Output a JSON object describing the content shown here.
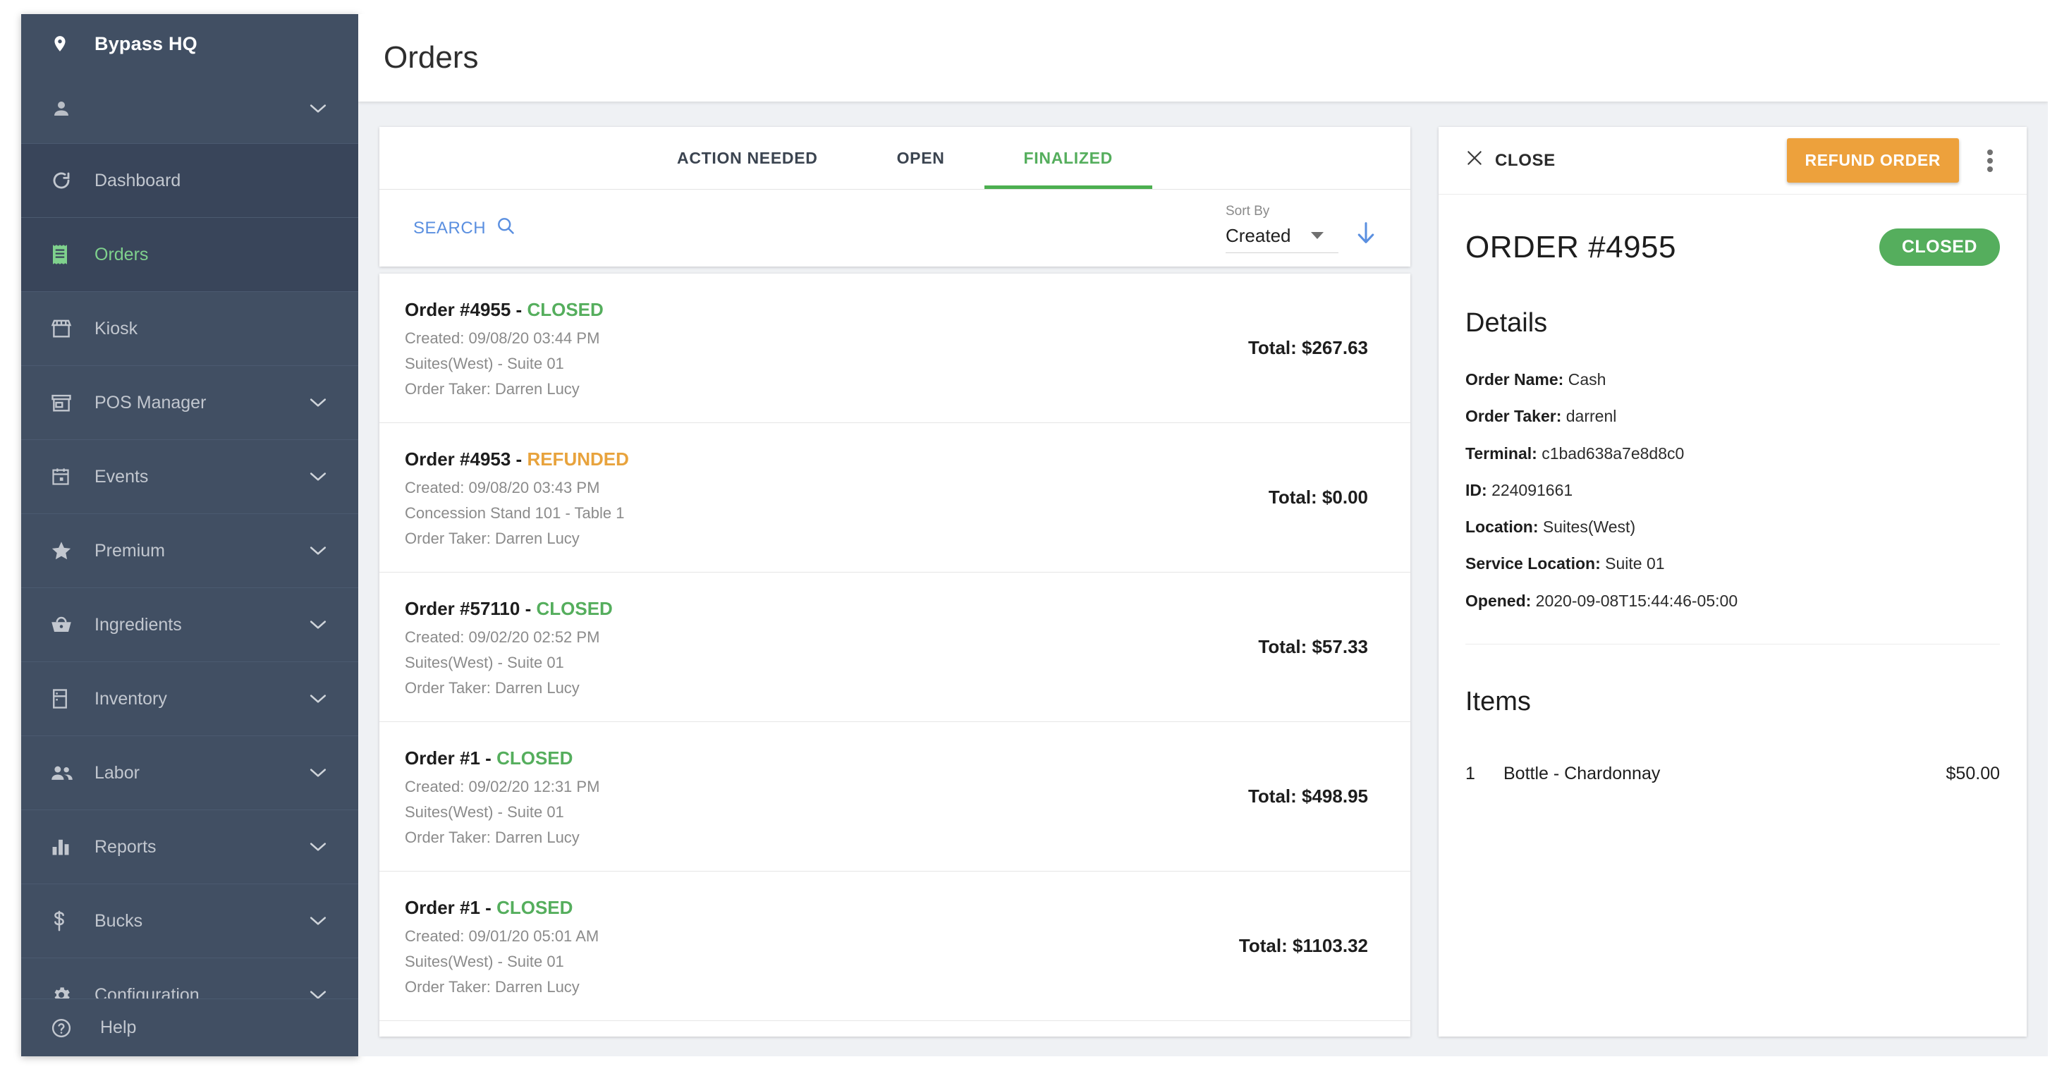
{
  "colors": {
    "sidebar_bg": "#414f63",
    "sidebar_active_bg": "#39455a",
    "accent_green": "#55ae5d",
    "accent_orange": "#eda13c",
    "link_blue": "#5a8fe0",
    "page_bg": "#eff1f4"
  },
  "sidebar": {
    "brand": {
      "label": "Bypass HQ",
      "icon": "location-pin-icon"
    },
    "user": {
      "label": "",
      "icon": "person-icon",
      "chevron": "chevron-down-icon"
    },
    "items": [
      {
        "label": "Dashboard",
        "icon": "dashboard-icon",
        "expandable": false,
        "active": false,
        "highlight": true
      },
      {
        "label": "Orders",
        "icon": "receipt-icon",
        "expandable": false,
        "active": true,
        "highlight": true
      },
      {
        "label": "Kiosk",
        "icon": "kiosk-icon",
        "expandable": false,
        "active": false,
        "highlight": false
      },
      {
        "label": "POS Manager",
        "icon": "store-icon",
        "expandable": true,
        "active": false,
        "highlight": false
      },
      {
        "label": "Events",
        "icon": "calendar-icon",
        "expandable": true,
        "active": false,
        "highlight": false
      },
      {
        "label": "Premium",
        "icon": "star-icon",
        "expandable": true,
        "active": false,
        "highlight": false
      },
      {
        "label": "Ingredients",
        "icon": "basket-icon",
        "expandable": true,
        "active": false,
        "highlight": false
      },
      {
        "label": "Inventory",
        "icon": "fridge-icon",
        "expandable": true,
        "active": false,
        "highlight": false
      },
      {
        "label": "Labor",
        "icon": "people-icon",
        "expandable": true,
        "active": false,
        "highlight": false
      },
      {
        "label": "Reports",
        "icon": "bar-chart-icon",
        "expandable": true,
        "active": false,
        "highlight": false
      },
      {
        "label": "Bucks",
        "icon": "dollar-icon",
        "expandable": true,
        "active": false,
        "highlight": false
      },
      {
        "label": "Configuration",
        "icon": "gear-icon",
        "expandable": true,
        "active": false,
        "highlight": false
      }
    ],
    "help": {
      "label": "Help",
      "icon": "help-circle-icon"
    }
  },
  "header": {
    "title": "Orders"
  },
  "tabs": [
    {
      "label": "ACTION NEEDED",
      "selected": false
    },
    {
      "label": "OPEN",
      "selected": false
    },
    {
      "label": "FINALIZED",
      "selected": true
    }
  ],
  "toolbar": {
    "search_label": "SEARCH",
    "search_icon": "magnifier-icon",
    "sort_label": "Sort By",
    "sort_value": "Created",
    "sort_direction_icon": "arrow-down-icon"
  },
  "orders": [
    {
      "title_prefix": "Order #4955 - ",
      "status": "CLOSED",
      "created": "Created: 09/08/20 03:44 PM",
      "location": "Suites(West) - Suite 01",
      "taker": "Order Taker: Darren Lucy",
      "total": "Total: $267.63"
    },
    {
      "title_prefix": "Order #4953 - ",
      "status": "REFUNDED",
      "created": "Created: 09/08/20 03:43 PM",
      "location": "Concession Stand 101 - Table 1",
      "taker": "Order Taker: Darren Lucy",
      "total": "Total: $0.00"
    },
    {
      "title_prefix": "Order #57110 - ",
      "status": "CLOSED",
      "created": "Created: 09/02/20 02:52 PM",
      "location": "Suites(West) - Suite 01",
      "taker": "Order Taker: Darren Lucy",
      "total": "Total: $57.33"
    },
    {
      "title_prefix": "Order #1 - ",
      "status": "CLOSED",
      "created": "Created: 09/02/20 12:31 PM",
      "location": "Suites(West) - Suite 01",
      "taker": "Order Taker: Darren Lucy",
      "total": "Total: $498.95"
    },
    {
      "title_prefix": "Order #1 - ",
      "status": "CLOSED",
      "created": "Created: 09/01/20 05:01 AM",
      "location": "Suites(West) - Suite 01",
      "taker": "Order Taker: Darren Lucy",
      "total": "Total: $1103.32"
    }
  ],
  "detail": {
    "close_label": "CLOSE",
    "close_icon": "close-x-icon",
    "refund_label": "REFUND ORDER",
    "kebab_icon": "more-vertical-icon",
    "order_title": "ORDER #4955",
    "status_badge": "CLOSED",
    "details_heading": "Details",
    "fields": [
      {
        "label": "Order Name:",
        "value": "Cash"
      },
      {
        "label": "Order Taker:",
        "value": "darrenl"
      },
      {
        "label": "Terminal:",
        "value": "c1bad638a7e8d8c0"
      },
      {
        "label": "ID:",
        "value": "224091661"
      },
      {
        "label": "Location:",
        "value": "Suites(West)"
      },
      {
        "label": "Service Location:",
        "value": "Suite 01"
      },
      {
        "label": "Opened:",
        "value": "2020-09-08T15:44:46-05:00"
      }
    ],
    "items_heading": "Items",
    "items": [
      {
        "qty": "1",
        "name": "Bottle - Chardonnay",
        "price": "$50.00"
      }
    ]
  }
}
